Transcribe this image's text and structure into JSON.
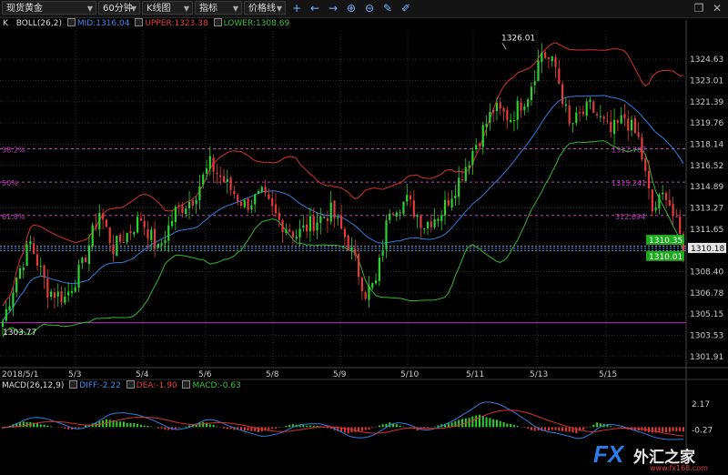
{
  "toolbar": {
    "symbol": "现货黄金",
    "period": "60分钟",
    "chart_kind": "K线图",
    "indicator": "指标",
    "price_line": "价格线",
    "tools": [
      "crosshair-icon",
      "arrow-left-icon",
      "arrow-right-icon",
      "zoom-in-icon",
      "zoom-out-icon",
      "pencil-icon",
      "brush-icon"
    ],
    "window_controls": [
      "restore-icon",
      "close-icon"
    ]
  },
  "price_indicator": {
    "k_label": "K",
    "boll_label": "BOLL(26,2)",
    "mid_label": "MID:1316.04",
    "upper_label": "UPPER:1323.38",
    "lower_label": "LOWER:1308.69"
  },
  "macd_indicator": {
    "label": "MACD(26,12,9)",
    "diff_label": "DIFF:-2.22",
    "dea_label": "DEA:-1.90",
    "macd_label": "MACD:-0.63"
  },
  "colors": {
    "up": "#2fd12f",
    "down": "#e23b3b",
    "mid": "#2f7fe0",
    "upper": "#d63030",
    "lower": "#2fb82f",
    "fib": "#c040c0",
    "grid": "#2b2b2b"
  },
  "chart_data": {
    "type": "candlestick",
    "symbol": "现货黄金",
    "period": "60分钟",
    "y_ticks": [
      1324.63,
      1323.01,
      1321.39,
      1319.76,
      1318.14,
      1316.52,
      1314.89,
      1313.27,
      1311.65,
      1310.02,
      1308.4,
      1306.78,
      1305.15,
      1303.53,
      1301.91
    ],
    "x_ticks": [
      "2018/5/1",
      "5/3",
      "5/4",
      "5/6",
      "5/8",
      "5/9",
      "5/10",
      "5/11",
      "5/13",
      "5/15"
    ],
    "ylim": [
      1301.2,
      1326.8
    ],
    "high_label": "1326.01",
    "low_label": "1303.77",
    "fib_levels": [
      {
        "label": "38.2%",
        "value": 1317.787
      },
      {
        "label": "50%",
        "value": 1315.241
      },
      {
        "label": "61.8%",
        "value": 1312.694
      }
    ],
    "fib_right_labels": [
      "1317.787",
      "1315.241",
      "312.694"
    ],
    "support_line": 1304.5,
    "dashed_lines": [
      1310.35,
      1310.18,
      1310.01
    ],
    "price_tags": {
      "upper": "1310.35",
      "current": "1310.18",
      "lower": "1310.01"
    },
    "close_anchors": [
      [
        0,
        1304.6
      ],
      [
        4,
        1308.0
      ],
      [
        8,
        1310.6
      ],
      [
        13,
        1307.0
      ],
      [
        18,
        1306.4
      ],
      [
        23,
        1308.8
      ],
      [
        28,
        1313.0
      ],
      [
        32,
        1310.2
      ],
      [
        36,
        1311.3
      ],
      [
        40,
        1312.5
      ],
      [
        45,
        1310.0
      ],
      [
        50,
        1313.0
      ],
      [
        55,
        1314.0
      ],
      [
        60,
        1316.6
      ],
      [
        65,
        1315.0
      ],
      [
        70,
        1313.5
      ],
      [
        75,
        1314.2
      ],
      [
        80,
        1312.3
      ],
      [
        85,
        1311.2
      ],
      [
        90,
        1312.2
      ],
      [
        95,
        1313.0
      ],
      [
        100,
        1310.6
      ],
      [
        105,
        1306.8
      ],
      [
        108,
        1307.5
      ],
      [
        112,
        1313.3
      ],
      [
        117,
        1313.8
      ],
      [
        122,
        1312.0
      ],
      [
        127,
        1313.0
      ],
      [
        132,
        1315.4
      ],
      [
        137,
        1318.2
      ],
      [
        142,
        1320.8
      ],
      [
        147,
        1320.2
      ],
      [
        152,
        1322.0
      ],
      [
        156,
        1325.2
      ],
      [
        160,
        1324.0
      ],
      [
        164,
        1319.5
      ],
      [
        170,
        1321.0
      ],
      [
        176,
        1319.0
      ],
      [
        180,
        1320.2
      ],
      [
        184,
        1318.5
      ],
      [
        188,
        1313.0
      ],
      [
        192,
        1314.5
      ],
      [
        197,
        1310.2
      ]
    ],
    "macd": {
      "ylim": [
        -1.6,
        3.2
      ],
      "y_ticks": [
        2.17,
        -0.27
      ],
      "hist_anchors": [
        [
          0,
          -0.1
        ],
        [
          6,
          0.55
        ],
        [
          12,
          0.2
        ],
        [
          20,
          -0.25
        ],
        [
          30,
          0.7
        ],
        [
          40,
          0.25
        ],
        [
          48,
          -0.3
        ],
        [
          58,
          0.5
        ],
        [
          64,
          -0.15
        ],
        [
          74,
          -0.45
        ],
        [
          84,
          0.25
        ],
        [
          92,
          0.05
        ],
        [
          100,
          -0.6
        ],
        [
          106,
          -0.2
        ],
        [
          112,
          0.45
        ],
        [
          120,
          -0.3
        ],
        [
          128,
          0.3
        ],
        [
          138,
          1.15
        ],
        [
          146,
          0.35
        ],
        [
          154,
          -0.35
        ],
        [
          160,
          -0.3
        ],
        [
          166,
          -0.55
        ],
        [
          172,
          0.4
        ],
        [
          180,
          -0.15
        ],
        [
          188,
          -0.5
        ],
        [
          197,
          -0.4
        ]
      ]
    }
  }
}
